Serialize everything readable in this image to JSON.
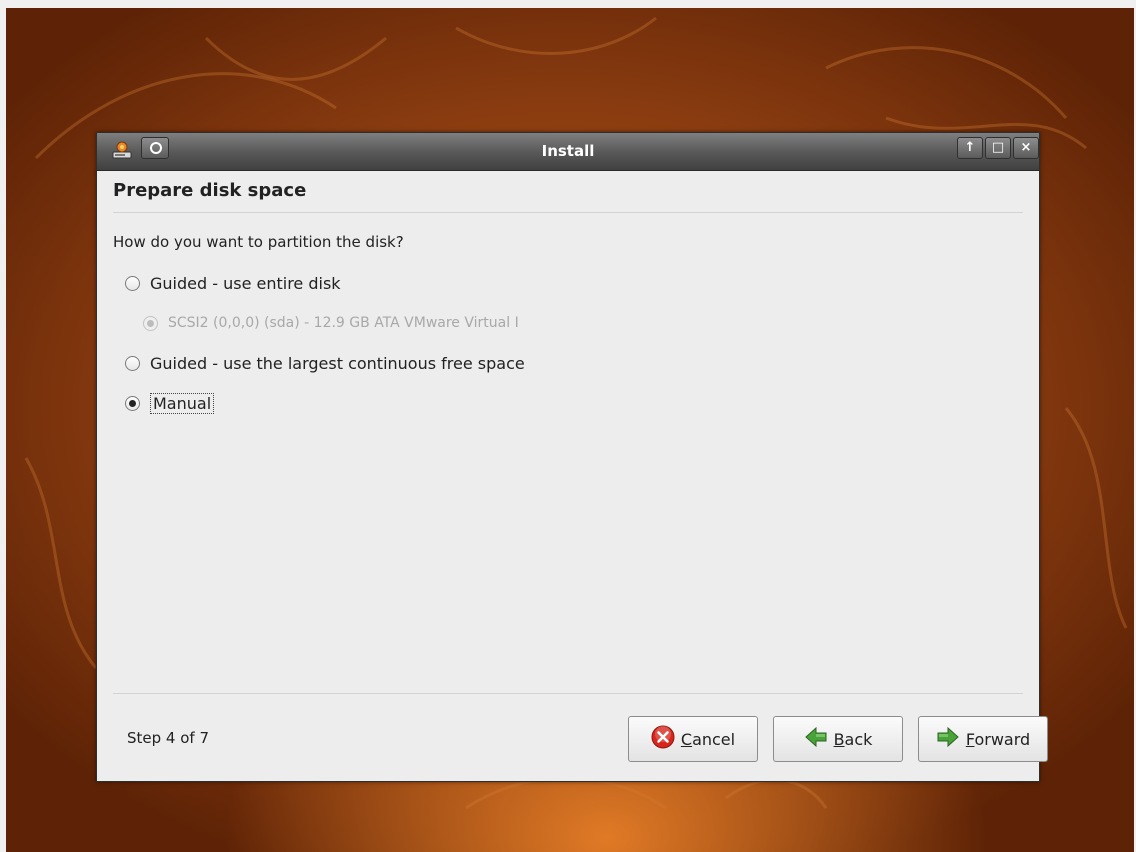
{
  "window": {
    "title": "Install",
    "buttons": {
      "up": "↑",
      "maximize": "□",
      "close": "×"
    }
  },
  "page": {
    "heading": "Prepare disk space",
    "question": "How do you want to partition the disk?"
  },
  "options": [
    {
      "label": "Guided - use entire disk",
      "checked": false,
      "disabled": false
    },
    {
      "label": "SCSI2 (0,0,0) (sda) - 12.9 GB ATA VMware Virtual I",
      "checked": true,
      "disabled": true
    },
    {
      "label": "Guided - use the largest continuous free space",
      "checked": false,
      "disabled": false
    },
    {
      "label": "Manual",
      "checked": true,
      "disabled": false
    }
  ],
  "footer": {
    "step": "Step 4 of 7",
    "cancel_mnemonic": "C",
    "cancel_rest": "ancel",
    "back_mnemonic": "B",
    "back_rest": "ack",
    "forward_mnemonic": "F",
    "forward_rest": "orward"
  },
  "icons": {
    "app": "installer-icon",
    "menu": "window-menu-icon",
    "cancel": "cancel-icon",
    "back": "back-arrow-icon",
    "forward": "forward-arrow-icon"
  },
  "colors": {
    "desktop_orange": "#b85b1c",
    "titlebar": "#5a5a5a",
    "cancel_red": "#d9261c",
    "arrow_green": "#4aa33a"
  }
}
